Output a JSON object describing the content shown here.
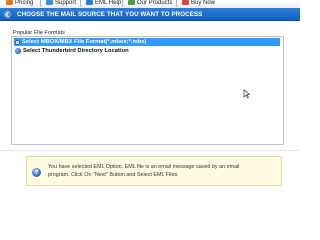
{
  "toolbar": {
    "items": [
      {
        "label": "Pricing",
        "icon": "pricing-icon",
        "color": "#e07a1f"
      },
      {
        "label": "Support",
        "icon": "support-icon",
        "color": "#3a8be0"
      },
      {
        "label": "EML Help",
        "icon": "help-icon",
        "color": "#2f7fd8"
      },
      {
        "label": "Our Products",
        "icon": "products-icon",
        "color": "#4a9a3a"
      },
      {
        "label": "Buy Now",
        "icon": "cart-icon",
        "color": "#d9473a"
      }
    ]
  },
  "header": {
    "title": "CHOOSE THE MAIL SOURCE THAT YOU WANT TO PROCESS",
    "icon": "back-arrow-icon",
    "background": "#1a6ad2"
  },
  "group": {
    "label": "Popular File Formats",
    "options": [
      {
        "label": "Select MBOX/MBX File Format(*.mbox;*.mbx)",
        "selected": true,
        "icon": "radio-icon"
      },
      {
        "label": "Select Thunderbird Directory Location",
        "selected": false,
        "icon": "thunderbird-icon"
      }
    ],
    "selection_color": "#3399ff"
  },
  "info": {
    "icon": "question-icon",
    "line1": "You have selected EML Option. EML file is an email message saved by an email",
    "line2": "program. Click On \"Next\" Button and Select EML Files.",
    "background": "#fffbe0"
  }
}
